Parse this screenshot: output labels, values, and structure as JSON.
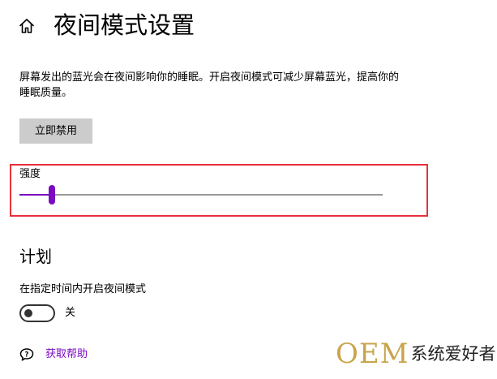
{
  "header": {
    "home_icon": "home-icon",
    "title": "夜间模式设置"
  },
  "description": "屏幕发出的蓝光会在夜间影响你的睡眠。开启夜间模式可减少屏幕蓝光，提高你的睡眠质量。",
  "disable_button": {
    "label": "立即禁用"
  },
  "strength": {
    "label": "强度",
    "value_fraction": 0.09,
    "accent_color": "#7a0bc0",
    "highlight_color": "#e8313a"
  },
  "schedule": {
    "title": "计划",
    "label": "在指定时间内开启夜间模式",
    "toggle_on": false,
    "toggle_state_label": "关"
  },
  "help": {
    "icon": "help-chat-icon",
    "label": "获取帮助"
  },
  "watermark": {
    "oem": "OEM",
    "text": "系统爱好者"
  }
}
